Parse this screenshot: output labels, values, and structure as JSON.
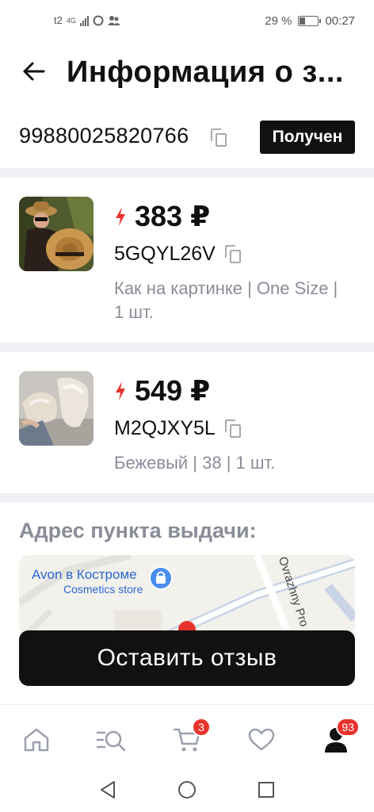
{
  "status_bar": {
    "network": "t2",
    "network_type": "4G",
    "battery": "29 %",
    "time": "00:27"
  },
  "header": {
    "title": "Информация о з..."
  },
  "order": {
    "number": "99880025820766",
    "status": "Получен"
  },
  "products": [
    {
      "price": "383 ₽",
      "sku": "5GQYL26V",
      "variant": "Как на картинке | One Size | 1 шт."
    },
    {
      "price": "549 ₽",
      "sku": "M2QJXY5L",
      "variant": "Бежевый | 38 | 1 шт."
    }
  ],
  "address": {
    "title": "Адрес пункта выдачи:",
    "map_place": "Avon в Костроме",
    "map_place_sub": "Cosmetics store",
    "map_street": "Ovrazhny Pro"
  },
  "review_button": "Оставить отзыв",
  "bottom_nav": {
    "cart_badge": "3",
    "profile_badge": "93"
  },
  "colors": {
    "accent_red": "#e8332d",
    "badge_black": "#111111",
    "muted_text": "#8a8d98"
  }
}
